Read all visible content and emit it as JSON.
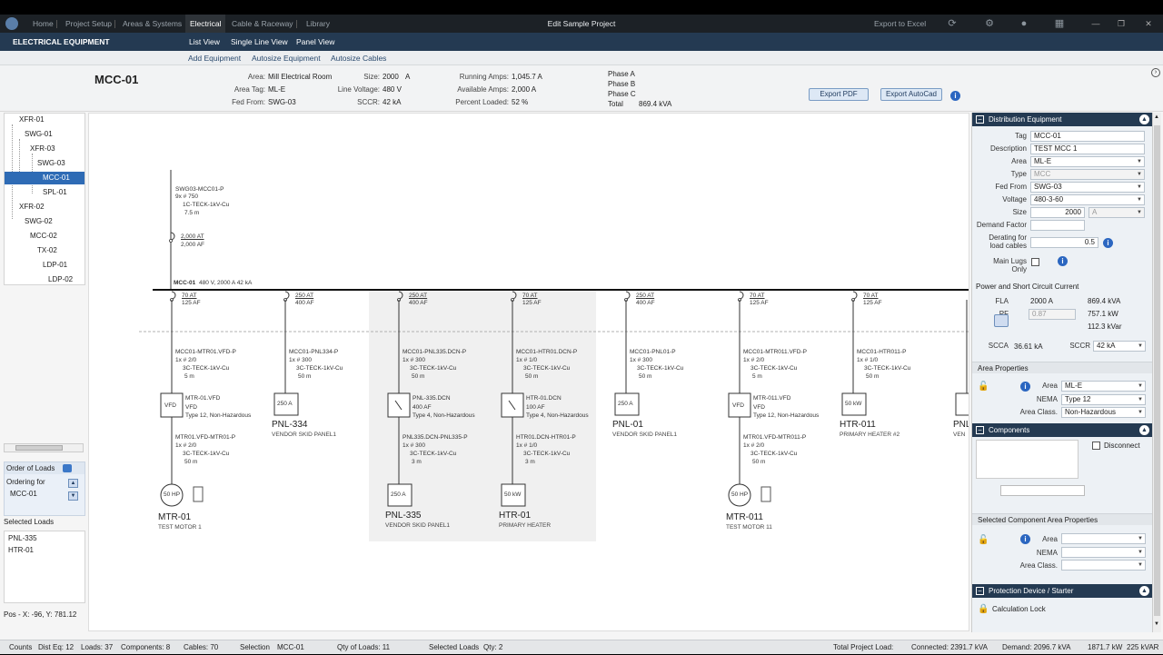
{
  "nav": {
    "tabs": [
      "Home",
      "Project Setup",
      "Areas & Systems",
      "Electrical",
      "Cable & Raceway",
      "Library"
    ],
    "title": "Edit Sample Project",
    "export_excel": "Export to Excel"
  },
  "section": {
    "title": "ELECTRICAL EQUIPMENT",
    "views": [
      "List View",
      "Single Line View",
      "Panel View"
    ]
  },
  "toolbar": {
    "actions": [
      "Add Equipment",
      "Autosize Equipment",
      "Autosize Cables"
    ]
  },
  "header": {
    "tag": "MCC-01",
    "area_label": "Area:",
    "area": "Mill Electrical Room",
    "area_tag_label": "Area Tag:",
    "area_tag": "ML-E",
    "fed_from_label": "Fed From:",
    "fed_from": "SWG-03",
    "size_label": "Size:",
    "size": "2000",
    "size_unit": "A",
    "line_voltage_label": "Line Voltage:",
    "line_voltage": "480 V",
    "sccr_label": "SCCR:",
    "sccr": "42 kA",
    "running_amps_label": "Running Amps:",
    "running_amps": "1,045.7 A",
    "available_amps_label": "Available Amps:",
    "available_amps": "2,000 A",
    "percent_loaded_label": "Percent Loaded:",
    "percent_loaded": "52 %",
    "phase_a": "Phase A",
    "phase_b": "Phase B",
    "phase_c": "Phase C",
    "total_label": "Total",
    "total": "869.4 kVA",
    "export_pdf": "Export PDF",
    "export_autocad": "Export AutoCad"
  },
  "tree": [
    "XFR-01",
    "SWG-01",
    "XFR-03",
    "SWG-03",
    "MCC-01",
    "SPL-01",
    "XFR-02",
    "SWG-02",
    "MCC-02",
    "TX-02",
    "LDP-01",
    "LDP-02"
  ],
  "order": {
    "title": "Order of Loads",
    "ordering_for_label": "Ordering for",
    "ordering_for": "MCC-01",
    "selected_loads_label": "Selected Loads",
    "selected_loads": [
      "PNL-335",
      "HTR-01"
    ]
  },
  "position": "Pos - X: -96, Y: 781.12",
  "diagram": {
    "feeder": {
      "cable_tag": "SWG03-MCC01-P",
      "cable_size": "9x # 750",
      "cable_type": "1C-TECK-1kV-Cu",
      "length": "7.5  m",
      "at": "2,000 AT",
      "af": "2,000 AF"
    },
    "bus": {
      "tag": "MCC-01",
      "info": "480 V,  2000 A  42 kA"
    },
    "branches": [
      {
        "at": "70 AT",
        "af": "125 AF",
        "cable_tag": "MCC01-MTR01.VFD-P",
        "cable_size": "1x # 2/0",
        "cable_type": "3C-TECK-1kV-Cu",
        "length": "5  m",
        "device": "VFD",
        "dev_tag": "MTR-01.VFD",
        "dev_l2": "VFD",
        "dev_l3": "Type 12, Non-Hazardous",
        "cable2_tag": "MTR01.VFD-MTR01-P",
        "cable2_size": "1x # 2/0",
        "cable2_type": "3C-TECK-1kV-Cu",
        "length2": "50  m",
        "load_rating": "50 HP",
        "load_tag": "MTR-01",
        "load_desc": "TEST MOTOR 1",
        "kind": "motor"
      },
      {
        "at": "250 AT",
        "af": "400 AF",
        "cable_tag": "MCC01-PNL334-P",
        "cable_size": "1x # 300",
        "cable_type": "3C-TECK-1kV-Cu",
        "length": "50  m",
        "load_rating": "250 A",
        "load_tag": "PNL-334",
        "load_desc": "VENDOR SKID PANEL1",
        "kind": "panel"
      },
      {
        "at": "250 AT",
        "af": "400 AF",
        "cable_tag": "MCC01-PNL335.DCN-P",
        "cable_size": "1x # 300",
        "cable_type": "3C-TECK-1kV-Cu",
        "length": "50  m",
        "device": "DCN",
        "dev_tag": "PNL-335.DCN",
        "dev_l2": "400 AF",
        "dev_l3": "Type 4, Non-Hazardous",
        "cable2_tag": "PNL335.DCN-PNL335-P",
        "cable2_size": "1x # 300",
        "cable2_type": "3C-TECK-1kV-Cu",
        "length2": "3  m",
        "load_rating": "250 A",
        "load_tag": "PNL-335",
        "load_desc": "VENDOR SKID PANEL1",
        "kind": "panel-deep"
      },
      {
        "at": "70 AT",
        "af": "125 AF",
        "cable_tag": "MCC01-HTR01.DCN-P",
        "cable_size": "1x # 1/0",
        "cable_type": "3C-TECK-1kV-Cu",
        "length": "50  m",
        "device": "DCN",
        "dev_tag": "HTR-01.DCN",
        "dev_l2": "100 AF",
        "dev_l3": "Type 4, Non-Hazardous",
        "cable2_tag": "HTR01.DCN-HTR01-P",
        "cable2_size": "1x # 1/0",
        "cable2_type": "3C-TECK-1kV-Cu",
        "length2": "3  m",
        "load_rating": "50 kW",
        "load_tag": "HTR-01",
        "load_desc": "PRIMARY HEATER",
        "kind": "panel-deep"
      },
      {
        "at": "250 AT",
        "af": "400 AF",
        "cable_tag": "MCC01-PNL01-P",
        "cable_size": "1x # 300",
        "cable_type": "3C-TECK-1kV-Cu",
        "length": "50  m",
        "load_rating": "250 A",
        "load_tag": "PNL-01",
        "load_desc": "VENDOR SKID PANEL1",
        "kind": "panel"
      },
      {
        "at": "70 AT",
        "af": "125 AF",
        "cable_tag": "MCC01-MTR011.VFD-P",
        "cable_size": "1x # 2/0",
        "cable_type": "3C-TECK-1kV-Cu",
        "length": "5  m",
        "device": "VFD",
        "dev_tag": "MTR-011.VFD",
        "dev_l2": "VFD",
        "dev_l3": "Type 12, Non-Hazardous",
        "cable2_tag": "MTR01.VFD-MTR011-P",
        "cable2_size": "1x # 2/0",
        "cable2_type": "3C-TECK-1kV-Cu",
        "length2": "50  m",
        "load_rating": "50 HP",
        "load_tag": "MTR-011",
        "load_desc": "TEST MOTOR 11",
        "kind": "motor"
      },
      {
        "at": "70 AT",
        "af": "125 AF",
        "cable_tag": "MCC01-HTR011-P",
        "cable_size": "1x # 1/0",
        "cable_type": "3C-TECK-1kV-Cu",
        "length": "50  m",
        "load_rating": "50 kW",
        "load_tag": "HTR-011",
        "load_desc": "PRIMARY HEATER #2",
        "kind": "panel"
      }
    ],
    "partial_load_tag": "PNL",
    "partial_load_desc": "VEN"
  },
  "panel": {
    "dist_title": "Distribution Equipment",
    "tag_label": "Tag",
    "tag": "MCC-01",
    "desc_label": "Description",
    "desc": "TEST MCC 1",
    "area_label": "Area",
    "area": "ML-E",
    "type_label": "Type",
    "type": "MCC",
    "fed_label": "Fed From",
    "fed": "SWG-03",
    "voltage_label": "Voltage",
    "voltage": "480-3-60",
    "size_label": "Size",
    "size": "2000",
    "size_unit": "A",
    "demand_label": "Demand Factor",
    "derating_label1": "Derating for",
    "derating_label2": "load cables",
    "derating": "0.5",
    "mainlugs_label1": "Main Lugs",
    "mainlugs_label2": "Only",
    "psc_title": "Power and Short Circuit Current",
    "fla_label": "FLA",
    "fla": "2000 A",
    "kva": "869.4 kVA",
    "pf_label": "PF",
    "pf": "0.87",
    "kw": "757.1 kW",
    "kvar": "112.3 kVar",
    "scca_label": "SCCA",
    "scca": "36.61 kA",
    "sccr_label": "SCCR",
    "sccr": "42 kA",
    "area_props_title": "Area Properties",
    "ap_area_label": "Area",
    "ap_area": "ML-E",
    "ap_nema_label": "NEMA",
    "ap_nema": "Type 12",
    "ap_class_label": "Area Class.",
    "ap_class": "Non-Hazardous",
    "components_title": "Components",
    "disconnect_label": "Disconnect",
    "sel_comp_title": "Selected Component Area Properties",
    "sc_area_label": "Area",
    "sc_nema_label": "NEMA",
    "sc_class_label": "Area Class.",
    "protection_title": "Protection Device / Starter",
    "calc_lock_label": "Calculation Lock"
  },
  "status": {
    "counts_label": "Counts",
    "dist_eq": "Dist Eq:  12",
    "loads": "Loads:  37",
    "components": "Components:  8",
    "cables": "Cables:  70",
    "selection_label": "Selection",
    "selection": "MCC-01",
    "qty_loads": "Qty of Loads:   11",
    "selected_loads_label": "Selected Loads",
    "selected_qty": "Qty:   2",
    "total_label": "Total Project Load:",
    "connected": "Connected:   2391.7 kVA",
    "demand": "Demand:   2096.7 kVA",
    "kw": "1871.7 kW",
    "kvar": "225 kVAR"
  }
}
